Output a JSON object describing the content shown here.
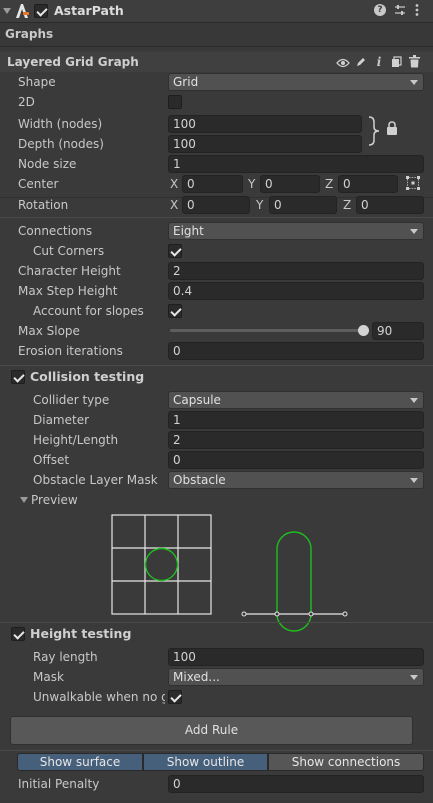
{
  "header": {
    "title": "AstarPath",
    "enabled": true
  },
  "graphs_label": "Graphs",
  "graph": {
    "title": "Layered Grid Graph",
    "shape": {
      "label": "Shape",
      "value": "Grid"
    },
    "two_d": {
      "label": "2D",
      "checked": false
    },
    "width": {
      "label": "Width (nodes)",
      "value": "100"
    },
    "depth": {
      "label": "Depth (nodes)",
      "value": "100"
    },
    "node_size": {
      "label": "Node size",
      "value": "1"
    },
    "center": {
      "label": "Center",
      "x": "0",
      "y": "0",
      "z": "0"
    },
    "rotation": {
      "label": "Rotation",
      "x": "0",
      "y": "0",
      "z": "0"
    },
    "axes": {
      "x": "X",
      "y": "Y",
      "z": "Z"
    },
    "connections": {
      "label": "Connections",
      "value": "Eight"
    },
    "cut_corners": {
      "label": "Cut Corners",
      "checked": true
    },
    "character_height": {
      "label": "Character Height",
      "value": "2"
    },
    "max_step_height": {
      "label": "Max Step Height",
      "value": "0.4"
    },
    "account_for_slopes": {
      "label": "Account for slopes",
      "checked": true
    },
    "max_slope": {
      "label": "Max Slope",
      "value": "90",
      "fraction": 1.0
    },
    "erosion": {
      "label": "Erosion iterations",
      "value": "0"
    }
  },
  "collision": {
    "title": "Collision testing",
    "enabled": true,
    "collider_type": {
      "label": "Collider type",
      "value": "Capsule"
    },
    "diameter": {
      "label": "Diameter",
      "value": "1"
    },
    "height_length": {
      "label": "Height/Length",
      "value": "2"
    },
    "offset": {
      "label": "Offset",
      "value": "0"
    },
    "layer_mask": {
      "label": "Obstacle Layer Mask",
      "value": "Obstacle"
    },
    "preview_label": "Preview"
  },
  "height": {
    "title": "Height testing",
    "enabled": true,
    "ray_length": {
      "label": "Ray length",
      "value": "100"
    },
    "mask": {
      "label": "Mask",
      "value": "Mixed..."
    },
    "unwalkable": {
      "label": "Unwalkable when no gr",
      "checked": true
    }
  },
  "add_rule_label": "Add Rule",
  "toggles": {
    "surface": "Show surface",
    "outline": "Show outline",
    "connections": "Show connections",
    "surface_on": true,
    "outline_on": true,
    "connections_on": false
  },
  "initial_penalty": {
    "label": "Initial Penalty",
    "value": "0"
  },
  "colors": {
    "accent_toggle": "#46607c",
    "preview_green": "#1fbf1f"
  },
  "icons": [
    "astar-logo-icon",
    "help-icon",
    "settings-sliders-icon",
    "kebab-menu-icon",
    "eye-icon",
    "pencil-icon",
    "info-icon",
    "copy-icon",
    "trash-icon",
    "lock-icon",
    "grid-snap-icon"
  ]
}
